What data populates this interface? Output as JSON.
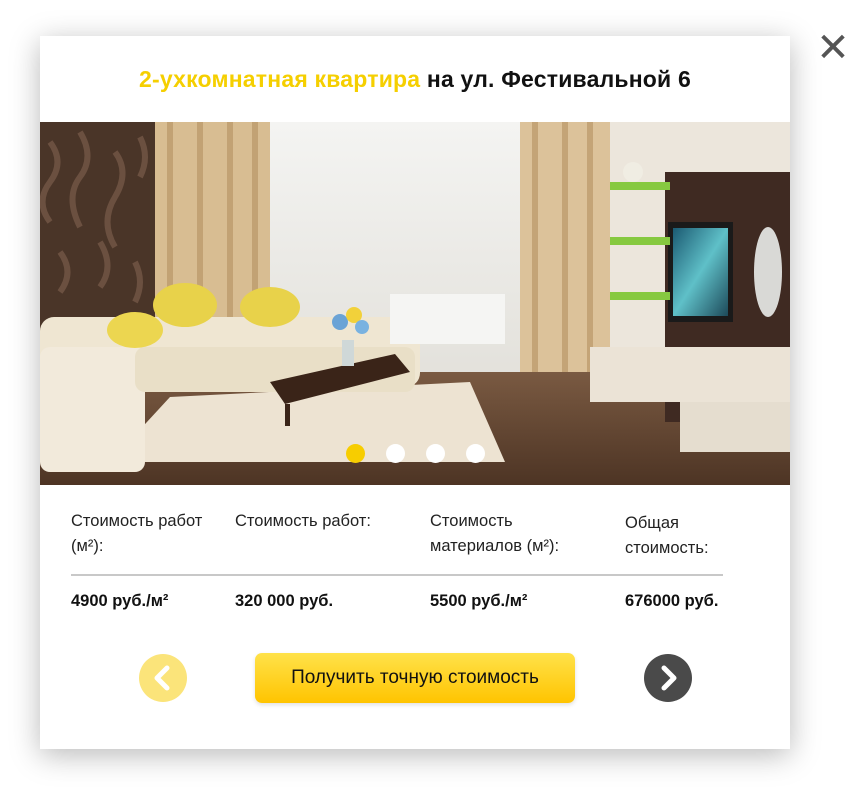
{
  "popup": {
    "close_icon": "close-icon",
    "title_accent": "2-ухкомнатная квартира",
    "title_rest": " на ул. Фестивальной 6"
  },
  "gallery": {
    "image": "living-room-photo",
    "slide_count": 4,
    "active_slide": 1
  },
  "specs": [
    {
      "label": "Стоимость работ (м²):",
      "value": "4900 руб./м²"
    },
    {
      "label": "Стоимость работ:",
      "value": "320 000 руб."
    },
    {
      "label": "Стоимость материалов (м²):",
      "value": "5500 руб./м²"
    },
    {
      "label": "Общая стоимость:",
      "value": "676000 руб."
    }
  ],
  "actions": {
    "cta_label": "Получить точную стоимость",
    "prev_icon": "chevron-left-icon",
    "next_icon": "chevron-right-icon"
  },
  "colors": {
    "accent": "#f5cf00",
    "cta": "#ffd21a",
    "prev_button": "#fbe47a",
    "next_button": "#4a4a4a"
  }
}
